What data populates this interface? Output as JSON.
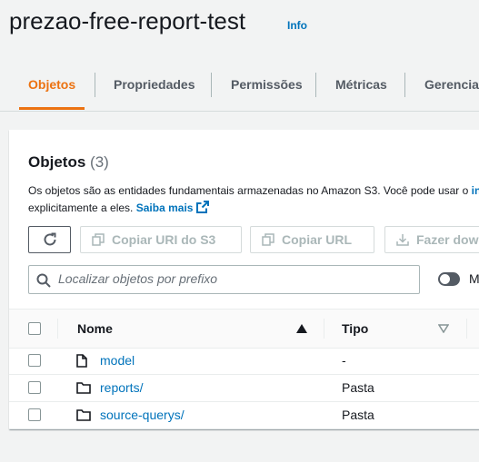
{
  "bucket": {
    "name": "prezao-free-report-test",
    "info_label": "Info"
  },
  "tabs": [
    {
      "label": "Objetos",
      "active": true
    },
    {
      "label": "Propriedades"
    },
    {
      "label": "Permissões"
    },
    {
      "label": "Métricas"
    },
    {
      "label": "Gerenciar"
    }
  ],
  "objects_panel": {
    "title": "Objetos",
    "count": "(3)",
    "description_line1": "Os objetos são as entidades fundamentais armazenadas no Amazon S3. Você pode usar o",
    "description_link_fragment": "in",
    "description_line2": "explicitamente a eles.",
    "learn_more": "Saiba mais"
  },
  "toolbar": {
    "copy_s3_uri": "Copiar URI do S3",
    "copy_url": "Copiar URL",
    "download": "Fazer dow"
  },
  "search": {
    "placeholder": "Localizar objetos por prefixo"
  },
  "toggle_label": "M",
  "table": {
    "headers": {
      "name": "Nome",
      "type": "Tipo"
    },
    "rows": [
      {
        "name": "model",
        "type": "-",
        "icon": "file-icon"
      },
      {
        "name": "reports/",
        "type": "Pasta",
        "icon": "folder-icon"
      },
      {
        "name": "source-querys/",
        "type": "Pasta",
        "icon": "folder-icon"
      }
    ]
  },
  "colors": {
    "accent": "#ec7211",
    "link": "#0073bb",
    "text": "#16191f",
    "muted": "#687078"
  }
}
